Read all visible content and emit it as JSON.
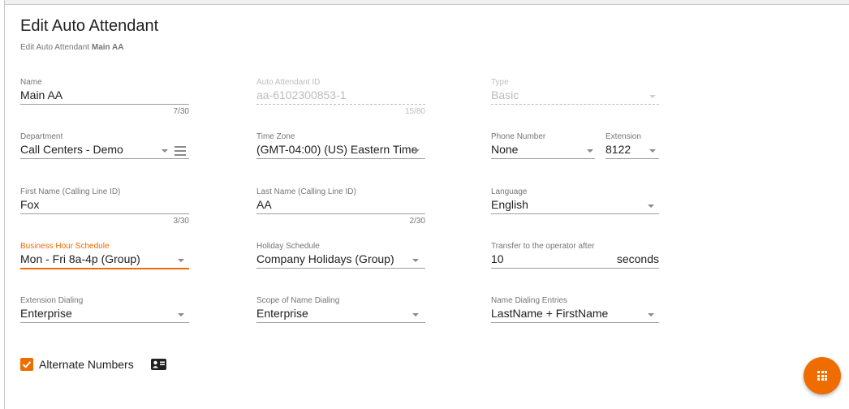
{
  "header": {
    "title": "Edit Auto Attendant",
    "subtitle_prefix": "Edit Auto Attendant",
    "subtitle_name": "Main AA"
  },
  "fields": {
    "name": {
      "label": "Name",
      "value": "Main AA",
      "counter": "7/30"
    },
    "aa_id": {
      "label": "Auto Attendant ID",
      "value": "aa-6102300853-1",
      "counter": "15/80"
    },
    "type": {
      "label": "Type",
      "value": "Basic"
    },
    "department": {
      "label": "Department",
      "value": "Call Centers - Demo"
    },
    "time_zone": {
      "label": "Time Zone",
      "value": "(GMT-04:00) (US) Eastern Time"
    },
    "phone_number": {
      "label": "Phone Number",
      "value": "None"
    },
    "extension": {
      "label": "Extension",
      "value": "8122"
    },
    "first_name": {
      "label": "First Name (Calling Line ID)",
      "value": "Fox",
      "counter": "3/30"
    },
    "last_name": {
      "label": "Last Name (Calling Line ID)",
      "value": "AA",
      "counter": "2/30"
    },
    "language": {
      "label": "Language",
      "value": "English"
    },
    "business_hours": {
      "label": "Business Hour Schedule",
      "value": "Mon - Fri 8a-4p (Group)"
    },
    "holiday": {
      "label": "Holiday Schedule",
      "value": "Company Holidays (Group)"
    },
    "transfer": {
      "label": "Transfer to the operator after",
      "value": "10",
      "suffix": "seconds"
    },
    "ext_dialing": {
      "label": "Extension Dialing",
      "value": "Enterprise"
    },
    "scope_name": {
      "label": "Scope of Name Dialing",
      "value": "Enterprise"
    },
    "name_entries": {
      "label": "Name Dialing Entries",
      "value": "LastName + FirstName"
    }
  },
  "alternate_numbers": {
    "label": "Alternate Numbers",
    "checked": true
  },
  "colors": {
    "accent": "#ef6c00",
    "text": "#212121",
    "muted": "#757575"
  },
  "icons": {
    "fab": "apps-grid-icon",
    "contact": "contact-card-icon",
    "department_menu": "menu-icon"
  }
}
